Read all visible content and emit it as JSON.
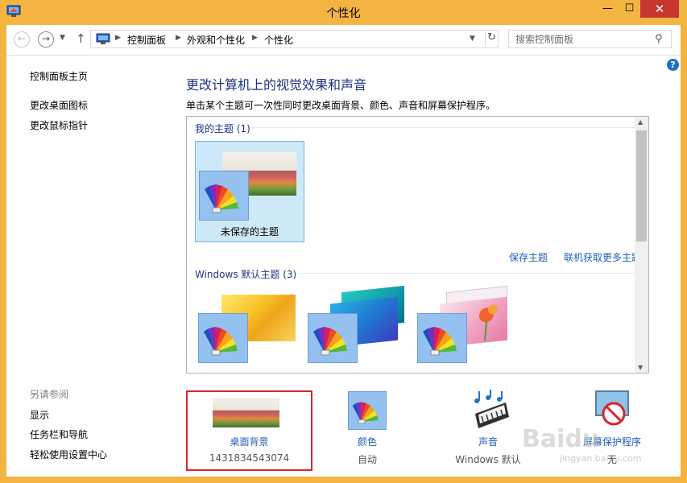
{
  "window": {
    "title": "个性化",
    "minimize": "—",
    "maximize": "☐",
    "close": "✕"
  },
  "address": {
    "breadcrumbs": [
      "控制面板",
      "外观和个性化",
      "个性化"
    ],
    "search_placeholder": "搜索控制面板"
  },
  "sidebar": {
    "home": "控制面板主页",
    "items": [
      "更改桌面图标",
      "更改鼠标指针"
    ],
    "see_also_title": "另请参阅",
    "see_also": [
      "显示",
      "任务栏和导航",
      "轻松使用设置中心"
    ]
  },
  "main": {
    "title": "更改计算机上的视觉效果和声音",
    "description": "单击某个主题可一次性同时更改桌面背景、颜色、声音和屏幕保护程序。",
    "my_themes_header": "我的主题 (1)",
    "my_themes": [
      {
        "label": "未保存的主题",
        "selected": true
      }
    ],
    "save_theme_link": "保存主题",
    "get_more_link": "联机获取更多主题",
    "default_themes_header": "Windows 默认主题 (3)"
  },
  "bottom": {
    "background": {
      "label": "桌面背景",
      "value": "1431834543074"
    },
    "color": {
      "label": "颜色",
      "value": "自动"
    },
    "sound": {
      "label": "声音",
      "value": "Windows 默认"
    },
    "screensaver": {
      "label": "屏幕保护程序",
      "value": "无"
    }
  },
  "watermark": {
    "brand": "Baidu",
    "sub": "jingyan.baidu.com"
  },
  "colors": {
    "frame": "#f3b442",
    "title_blue": "#1e3287",
    "link_blue": "#1e5fbf",
    "selection": "#cde8f7",
    "highlight_red": "#d8262b"
  }
}
